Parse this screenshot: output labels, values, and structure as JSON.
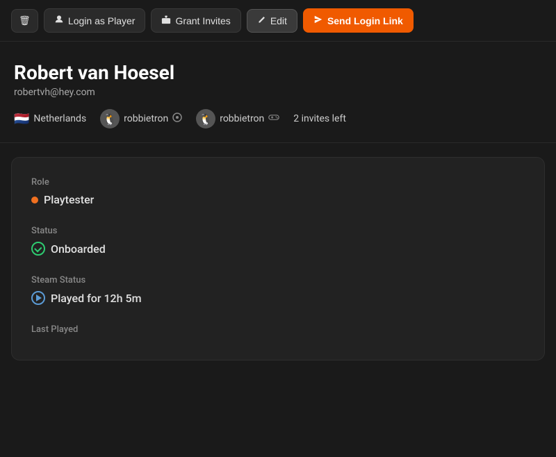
{
  "toolbar": {
    "delete_label": "",
    "login_as_player_label": "Login as Player",
    "grant_invites_label": "Grant Invites",
    "edit_label": "Edit",
    "send_login_link_label": "Send Login Link",
    "delete_icon": "🗑",
    "user_icon": "👤",
    "gift_icon": "🎁",
    "pencil_icon": "✏",
    "send_icon": "➤"
  },
  "profile": {
    "name": "Robert van Hoesel",
    "email": "robertvh@hey.com",
    "country": "Netherlands",
    "flag": "🇳🇱",
    "username1": "robbietron",
    "platform1_icon": "🐧",
    "platform1_badge": "⚙",
    "username2": "robbietron",
    "platform2_icon": "🐧",
    "platform2_badge": "🎮",
    "invites_left": "2 invites left"
  },
  "details": {
    "role_label": "Role",
    "role_value": "Playtester",
    "status_label": "Status",
    "status_value": "Onboarded",
    "steam_status_label": "Steam Status",
    "steam_status_value": "Played for 12h 5m",
    "last_played_label": "Last Played"
  }
}
